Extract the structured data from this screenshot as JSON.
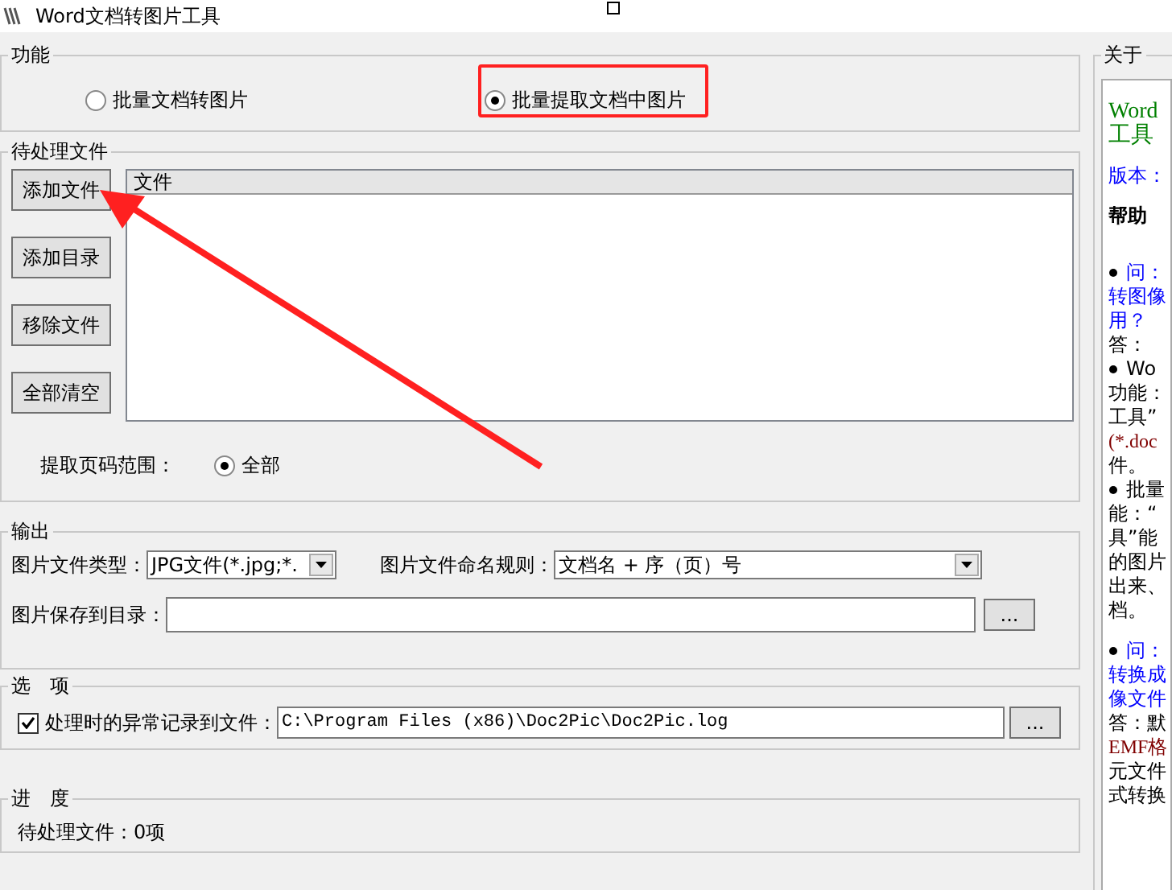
{
  "window": {
    "title": "Word文档转图片工具"
  },
  "function_group": {
    "title": "功能",
    "options": [
      {
        "label": "批量文档转图片",
        "selected": false
      },
      {
        "label": "批量提取文档中图片",
        "selected": true
      }
    ]
  },
  "pending_group": {
    "title": "待处理文件",
    "buttons": [
      "添加文件",
      "添加目录",
      "移除文件",
      "全部清空"
    ],
    "file_list": {
      "columns": [
        "文件"
      ]
    },
    "page_range": {
      "label": "提取页码范围：",
      "options": [
        {
          "label": "全部",
          "selected": true
        }
      ]
    }
  },
  "output_group": {
    "title": "输出",
    "file_type": {
      "label": "图片文件类型：",
      "value": "JPG文件(*.jpg;*."
    },
    "naming_rule": {
      "label": "图片文件命名规则：",
      "value": "文档名 + 序（页）号"
    },
    "save_dir": {
      "label": "图片保存到目录：",
      "browse": "..."
    }
  },
  "options_group": {
    "title": "选　项",
    "log": {
      "label": "处理时的异常记录到文件：",
      "checked": true,
      "value": "C:\\Program Files (x86)\\Doc2Pic\\Doc2Pic.log",
      "browse": "..."
    }
  },
  "progress_group": {
    "title": "进　度",
    "status": "待处理文件：0项"
  },
  "about_panel": {
    "title": "关于",
    "lines": [
      {
        "kind": "green",
        "text": "Word"
      },
      {
        "kind": "green",
        "text": "工具"
      },
      {
        "kind": "gap"
      },
      {
        "kind": "blue",
        "text": "版本："
      },
      {
        "kind": "gap"
      },
      {
        "kind": "bold",
        "text": "帮助"
      },
      {
        "kind": "gap"
      },
      {
        "kind": "gap"
      },
      {
        "kind": "bullet-blue",
        "text": "问："
      },
      {
        "kind": "blue",
        "text": "转图像"
      },
      {
        "kind": "blue",
        "text": "用？"
      },
      {
        "kind": "plain",
        "text": "答："
      },
      {
        "kind": "bullet",
        "text": "Wo"
      },
      {
        "kind": "plain",
        "text": "功能："
      },
      {
        "kind": "plain",
        "text": "工具”"
      },
      {
        "kind": "brown",
        "text": "(*.doc"
      },
      {
        "kind": "plain",
        "text": "件。"
      },
      {
        "kind": "bullet",
        "text": "批量"
      },
      {
        "kind": "plain",
        "text": "能：“"
      },
      {
        "kind": "plain",
        "text": "具”能"
      },
      {
        "kind": "plain",
        "text": "的图片"
      },
      {
        "kind": "plain",
        "text": "出来、"
      },
      {
        "kind": "plain",
        "text": "档。"
      },
      {
        "kind": "gap"
      },
      {
        "kind": "bullet-blue",
        "text": "问："
      },
      {
        "kind": "blue",
        "text": "转换成"
      },
      {
        "kind": "blue",
        "text": "像文件"
      },
      {
        "kind": "plain",
        "text": "答：默"
      },
      {
        "kind": "brown",
        "text": "EMF格"
      },
      {
        "kind": "plain",
        "text": "元文件"
      },
      {
        "kind": "plain",
        "text": "式转换"
      }
    ]
  }
}
